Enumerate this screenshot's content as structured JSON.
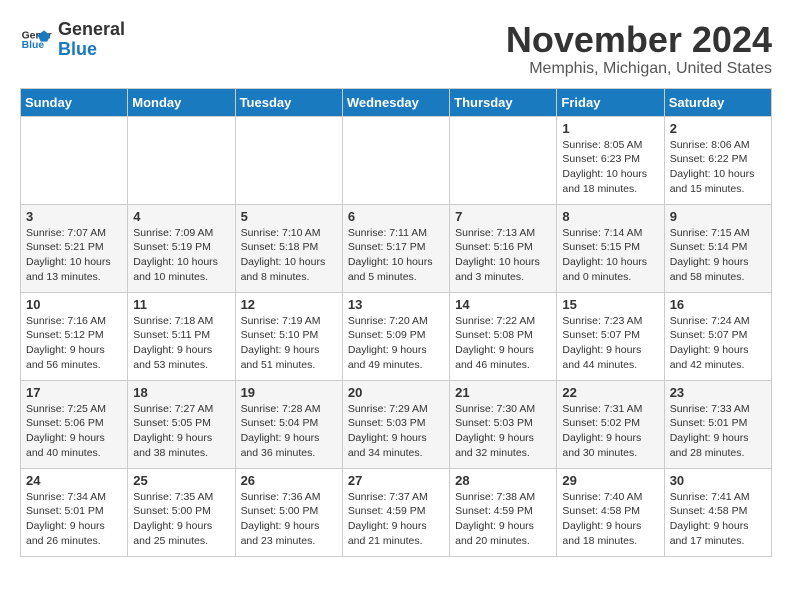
{
  "logo": {
    "line1": "General",
    "line2": "Blue"
  },
  "title": "November 2024",
  "location": "Memphis, Michigan, United States",
  "weekdays": [
    "Sunday",
    "Monday",
    "Tuesday",
    "Wednesday",
    "Thursday",
    "Friday",
    "Saturday"
  ],
  "weeks": [
    [
      {
        "day": "",
        "info": ""
      },
      {
        "day": "",
        "info": ""
      },
      {
        "day": "",
        "info": ""
      },
      {
        "day": "",
        "info": ""
      },
      {
        "day": "",
        "info": ""
      },
      {
        "day": "1",
        "info": "Sunrise: 8:05 AM\nSunset: 6:23 PM\nDaylight: 10 hours\nand 18 minutes."
      },
      {
        "day": "2",
        "info": "Sunrise: 8:06 AM\nSunset: 6:22 PM\nDaylight: 10 hours\nand 15 minutes."
      }
    ],
    [
      {
        "day": "3",
        "info": "Sunrise: 7:07 AM\nSunset: 5:21 PM\nDaylight: 10 hours\nand 13 minutes."
      },
      {
        "day": "4",
        "info": "Sunrise: 7:09 AM\nSunset: 5:19 PM\nDaylight: 10 hours\nand 10 minutes."
      },
      {
        "day": "5",
        "info": "Sunrise: 7:10 AM\nSunset: 5:18 PM\nDaylight: 10 hours\nand 8 minutes."
      },
      {
        "day": "6",
        "info": "Sunrise: 7:11 AM\nSunset: 5:17 PM\nDaylight: 10 hours\nand 5 minutes."
      },
      {
        "day": "7",
        "info": "Sunrise: 7:13 AM\nSunset: 5:16 PM\nDaylight: 10 hours\nand 3 minutes."
      },
      {
        "day": "8",
        "info": "Sunrise: 7:14 AM\nSunset: 5:15 PM\nDaylight: 10 hours\nand 0 minutes."
      },
      {
        "day": "9",
        "info": "Sunrise: 7:15 AM\nSunset: 5:14 PM\nDaylight: 9 hours\nand 58 minutes."
      }
    ],
    [
      {
        "day": "10",
        "info": "Sunrise: 7:16 AM\nSunset: 5:12 PM\nDaylight: 9 hours\nand 56 minutes."
      },
      {
        "day": "11",
        "info": "Sunrise: 7:18 AM\nSunset: 5:11 PM\nDaylight: 9 hours\nand 53 minutes."
      },
      {
        "day": "12",
        "info": "Sunrise: 7:19 AM\nSunset: 5:10 PM\nDaylight: 9 hours\nand 51 minutes."
      },
      {
        "day": "13",
        "info": "Sunrise: 7:20 AM\nSunset: 5:09 PM\nDaylight: 9 hours\nand 49 minutes."
      },
      {
        "day": "14",
        "info": "Sunrise: 7:22 AM\nSunset: 5:08 PM\nDaylight: 9 hours\nand 46 minutes."
      },
      {
        "day": "15",
        "info": "Sunrise: 7:23 AM\nSunset: 5:07 PM\nDaylight: 9 hours\nand 44 minutes."
      },
      {
        "day": "16",
        "info": "Sunrise: 7:24 AM\nSunset: 5:07 PM\nDaylight: 9 hours\nand 42 minutes."
      }
    ],
    [
      {
        "day": "17",
        "info": "Sunrise: 7:25 AM\nSunset: 5:06 PM\nDaylight: 9 hours\nand 40 minutes."
      },
      {
        "day": "18",
        "info": "Sunrise: 7:27 AM\nSunset: 5:05 PM\nDaylight: 9 hours\nand 38 minutes."
      },
      {
        "day": "19",
        "info": "Sunrise: 7:28 AM\nSunset: 5:04 PM\nDaylight: 9 hours\nand 36 minutes."
      },
      {
        "day": "20",
        "info": "Sunrise: 7:29 AM\nSunset: 5:03 PM\nDaylight: 9 hours\nand 34 minutes."
      },
      {
        "day": "21",
        "info": "Sunrise: 7:30 AM\nSunset: 5:03 PM\nDaylight: 9 hours\nand 32 minutes."
      },
      {
        "day": "22",
        "info": "Sunrise: 7:31 AM\nSunset: 5:02 PM\nDaylight: 9 hours\nand 30 minutes."
      },
      {
        "day": "23",
        "info": "Sunrise: 7:33 AM\nSunset: 5:01 PM\nDaylight: 9 hours\nand 28 minutes."
      }
    ],
    [
      {
        "day": "24",
        "info": "Sunrise: 7:34 AM\nSunset: 5:01 PM\nDaylight: 9 hours\nand 26 minutes."
      },
      {
        "day": "25",
        "info": "Sunrise: 7:35 AM\nSunset: 5:00 PM\nDaylight: 9 hours\nand 25 minutes."
      },
      {
        "day": "26",
        "info": "Sunrise: 7:36 AM\nSunset: 5:00 PM\nDaylight: 9 hours\nand 23 minutes."
      },
      {
        "day": "27",
        "info": "Sunrise: 7:37 AM\nSunset: 4:59 PM\nDaylight: 9 hours\nand 21 minutes."
      },
      {
        "day": "28",
        "info": "Sunrise: 7:38 AM\nSunset: 4:59 PM\nDaylight: 9 hours\nand 20 minutes."
      },
      {
        "day": "29",
        "info": "Sunrise: 7:40 AM\nSunset: 4:58 PM\nDaylight: 9 hours\nand 18 minutes."
      },
      {
        "day": "30",
        "info": "Sunrise: 7:41 AM\nSunset: 4:58 PM\nDaylight: 9 hours\nand 17 minutes."
      }
    ]
  ]
}
